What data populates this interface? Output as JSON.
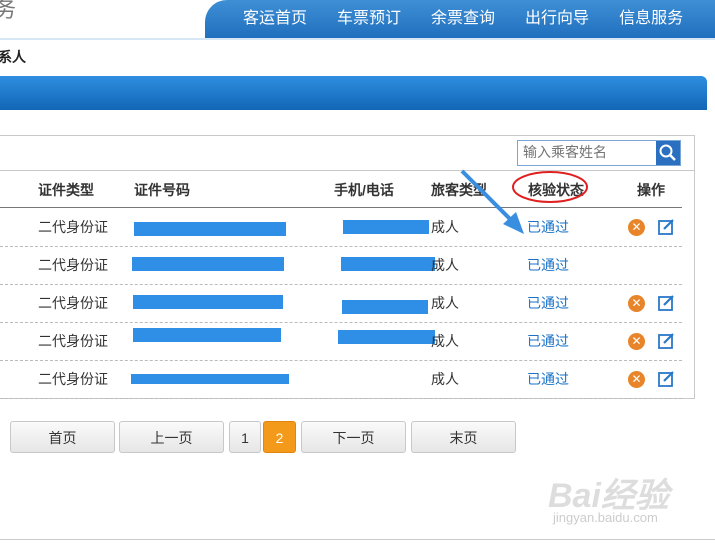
{
  "header": {
    "left_text": "务",
    "nav_items": [
      "客运首页",
      "车票预订",
      "余票查询",
      "出行向导",
      "信息服务"
    ]
  },
  "section_title": "系人",
  "search": {
    "placeholder": "输入乘客姓名"
  },
  "table": {
    "columns": [
      "证件类型",
      "证件号码",
      "手机/电话",
      "旅客类型",
      "核验状态",
      "操作"
    ],
    "rows": [
      {
        "id_type": "二代身份证",
        "passenger_type": "成人",
        "status": "已通过",
        "has_delete": true
      },
      {
        "id_type": "二代身份证",
        "passenger_type": "成人",
        "status": "已通过",
        "has_delete": false
      },
      {
        "id_type": "二代身份证",
        "passenger_type": "成人",
        "status": "已通过",
        "has_delete": true
      },
      {
        "id_type": "二代身份证",
        "passenger_type": "成人",
        "status": "已通过",
        "has_delete": true
      },
      {
        "id_type": "二代身份证",
        "passenger_type": "成人",
        "status": "已通过",
        "has_delete": true
      }
    ]
  },
  "pagination": {
    "first": "首页",
    "prev": "上一页",
    "pages": [
      "1",
      "2"
    ],
    "current": "2",
    "next": "下一页",
    "last": "末页"
  },
  "watermark": {
    "brand": "Bai经验",
    "url": "jingyan.baidu.com"
  },
  "colors": {
    "nav": "#1f6fbe",
    "status": "#1a72c8",
    "active_page": "#f39a1a",
    "highlight_circle": "#e02020",
    "arrow": "#3a8ee0"
  }
}
